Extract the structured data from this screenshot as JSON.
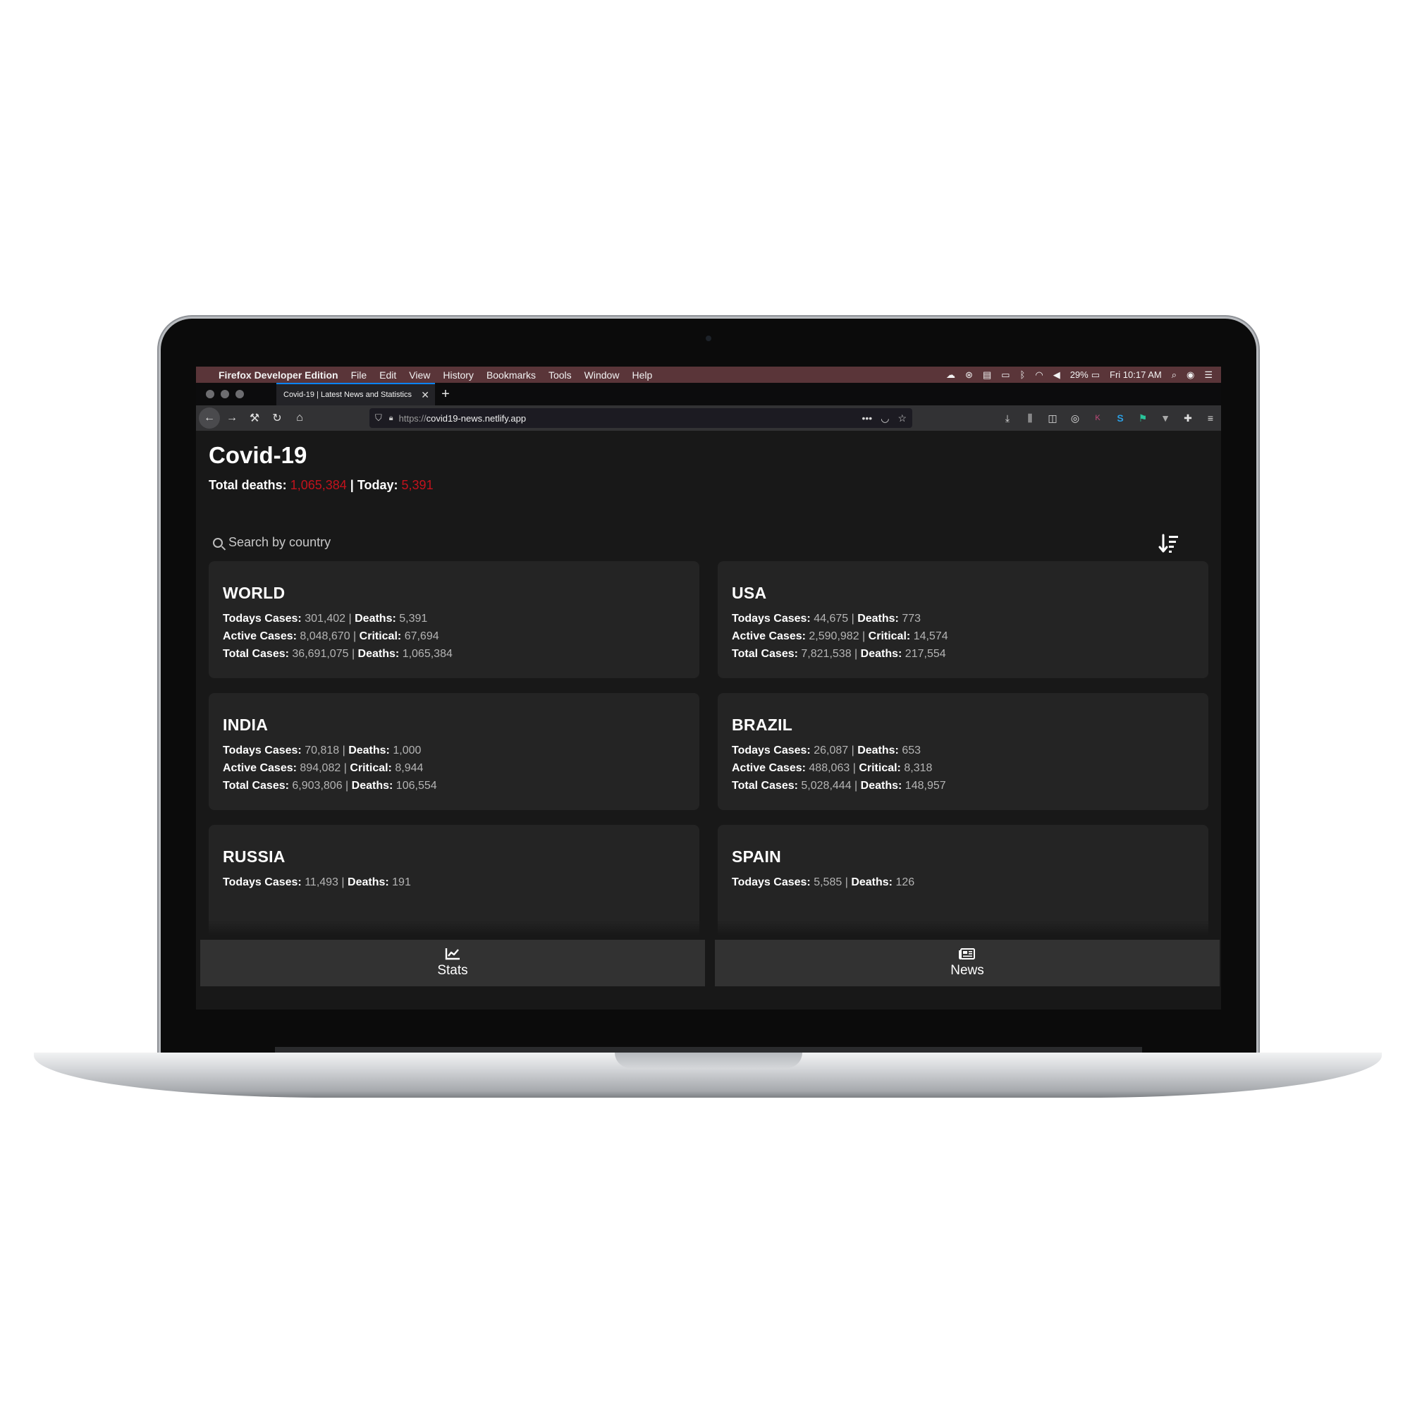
{
  "menubar": {
    "app_name": "Firefox Developer Edition",
    "menus": [
      "File",
      "Edit",
      "View",
      "History",
      "Bookmarks",
      "Tools",
      "Window",
      "Help"
    ],
    "battery": "29%",
    "clock": "Fri 10:17 AM"
  },
  "browser": {
    "tab_title": "Covid-19 | Latest News and Statistics",
    "url_protocol": "https://",
    "url_host": "covid19-news.netlify.app"
  },
  "page": {
    "title": "Covid-19",
    "total_deaths_label": "Total deaths:",
    "total_deaths_value": "1,065,384",
    "separator": "|",
    "today_label": "Today:",
    "today_value": "5,391",
    "search_placeholder": "Search by country"
  },
  "labels": {
    "todays_cases": "Todays Cases:",
    "deaths": "Deaths:",
    "active_cases": "Active Cases:",
    "critical": "Critical:",
    "total_cases": "Total Cases:",
    "sep": "|"
  },
  "countries": [
    {
      "name": "WORLD",
      "todays_cases": "301,402",
      "todays_deaths": "5,391",
      "active": "8,048,670",
      "critical": "67,694",
      "total_cases": "36,691,075",
      "total_deaths": "1,065,384"
    },
    {
      "name": "USA",
      "todays_cases": "44,675",
      "todays_deaths": "773",
      "active": "2,590,982",
      "critical": "14,574",
      "total_cases": "7,821,538",
      "total_deaths": "217,554"
    },
    {
      "name": "INDIA",
      "todays_cases": "70,818",
      "todays_deaths": "1,000",
      "active": "894,082",
      "critical": "8,944",
      "total_cases": "6,903,806",
      "total_deaths": "106,554"
    },
    {
      "name": "BRAZIL",
      "todays_cases": "26,087",
      "todays_deaths": "653",
      "active": "488,063",
      "critical": "8,318",
      "total_cases": "5,028,444",
      "total_deaths": "148,957"
    },
    {
      "name": "RUSSIA",
      "todays_cases": "11,493",
      "todays_deaths": "191"
    },
    {
      "name": "SPAIN",
      "todays_cases": "5,585",
      "todays_deaths": "126"
    }
  ],
  "bottom_nav": {
    "stats_label": "Stats",
    "news_label": "News"
  },
  "colors": {
    "accent_red": "#c2121c",
    "background": "#181818",
    "card": "#242424",
    "menubar": "#5a3539"
  }
}
